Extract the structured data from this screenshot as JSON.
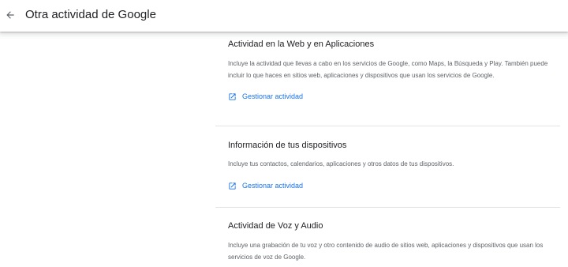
{
  "header": {
    "title": "Otra actividad de Google",
    "back_icon": "arrow-back-icon"
  },
  "colors": {
    "link": "#1a73e8",
    "title_text": "#202124",
    "secondary_text": "#5f6368",
    "divider": "#e3e3e3"
  },
  "sections": [
    {
      "title": "Actividad en la Web y en Aplicaciones",
      "description": "Incluye la actividad que llevas a cabo en los servicios de Google, como Maps, la Búsqueda y Play. También puede incluir lo que haces en sitios web, aplicaciones y dispositivos que usan los servicios de Google.",
      "link_label": "Gestionar actividad",
      "link_icon": "open-in-new-icon"
    },
    {
      "title": "Información de tus dispositivos",
      "description": "Incluye tus contactos, calendarios, aplicaciones y otros datos de tus dispositivos.",
      "link_label": "Gestionar actividad",
      "link_icon": "open-in-new-icon"
    },
    {
      "title": "Actividad de Voz y Audio",
      "description": "Incluye una grabación de tu voz y otro contenido de audio de sitios web, aplicaciones y dispositivos que usan los servicios de voz de Google."
    }
  ]
}
